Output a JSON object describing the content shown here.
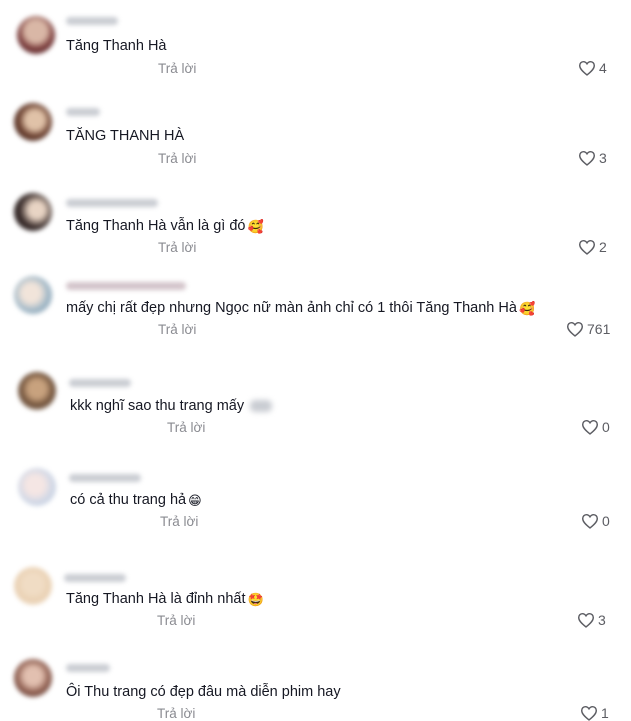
{
  "reply_label": "Trả lời",
  "comments": [
    {
      "text": "Tăng Thanh Hà",
      "likes": "4",
      "emoji": ""
    },
    {
      "text": "TĂNG THANH HÀ",
      "likes": "3",
      "emoji": ""
    },
    {
      "text": "Tăng Thanh Hà vẫn là gì đó",
      "likes": "2",
      "emoji": "🥰"
    },
    {
      "text": "mấy chị rất đẹp nhưng Ngọc nữ màn ảnh chỉ có 1 thôi Tăng Thanh Hà",
      "likes": "761",
      "emoji": "🥰"
    },
    {
      "text": "kkk nghĩ sao thu trang mấy",
      "likes": "0",
      "emoji": ""
    },
    {
      "text": "có cả thu trang hả",
      "likes": "0",
      "emoji": "😁"
    },
    {
      "text": "Tăng Thanh Hà là đỉnh nhất",
      "likes": "3",
      "emoji": "🤩"
    },
    {
      "text": "Ôi Thu trang có đẹp đâu mà diễn phim hay",
      "likes": "1",
      "emoji": ""
    }
  ],
  "colors": {
    "text": "#161823",
    "reply": "#8a8b91",
    "like": "#5c5d63"
  }
}
